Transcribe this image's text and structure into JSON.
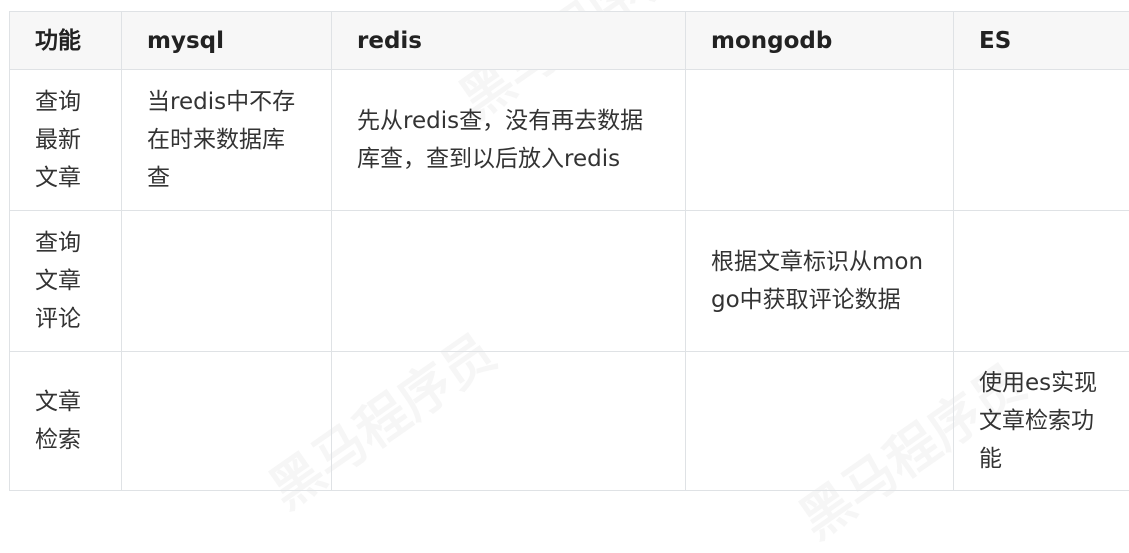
{
  "table": {
    "headers": [
      "功能",
      "mysql",
      "redis",
      "mongodb",
      "ES"
    ],
    "rows": [
      [
        "查询最新文章",
        "当redis中不存在时来数据库查",
        "先从redis查，没有再去数据库查，查到以后放入redis",
        "",
        ""
      ],
      [
        "查询文章评论",
        "",
        "",
        "根据文章标识从mongo中获取评论数据",
        ""
      ],
      [
        "文章检索",
        "",
        "",
        "",
        "使用es实现文章检索功能"
      ]
    ]
  }
}
